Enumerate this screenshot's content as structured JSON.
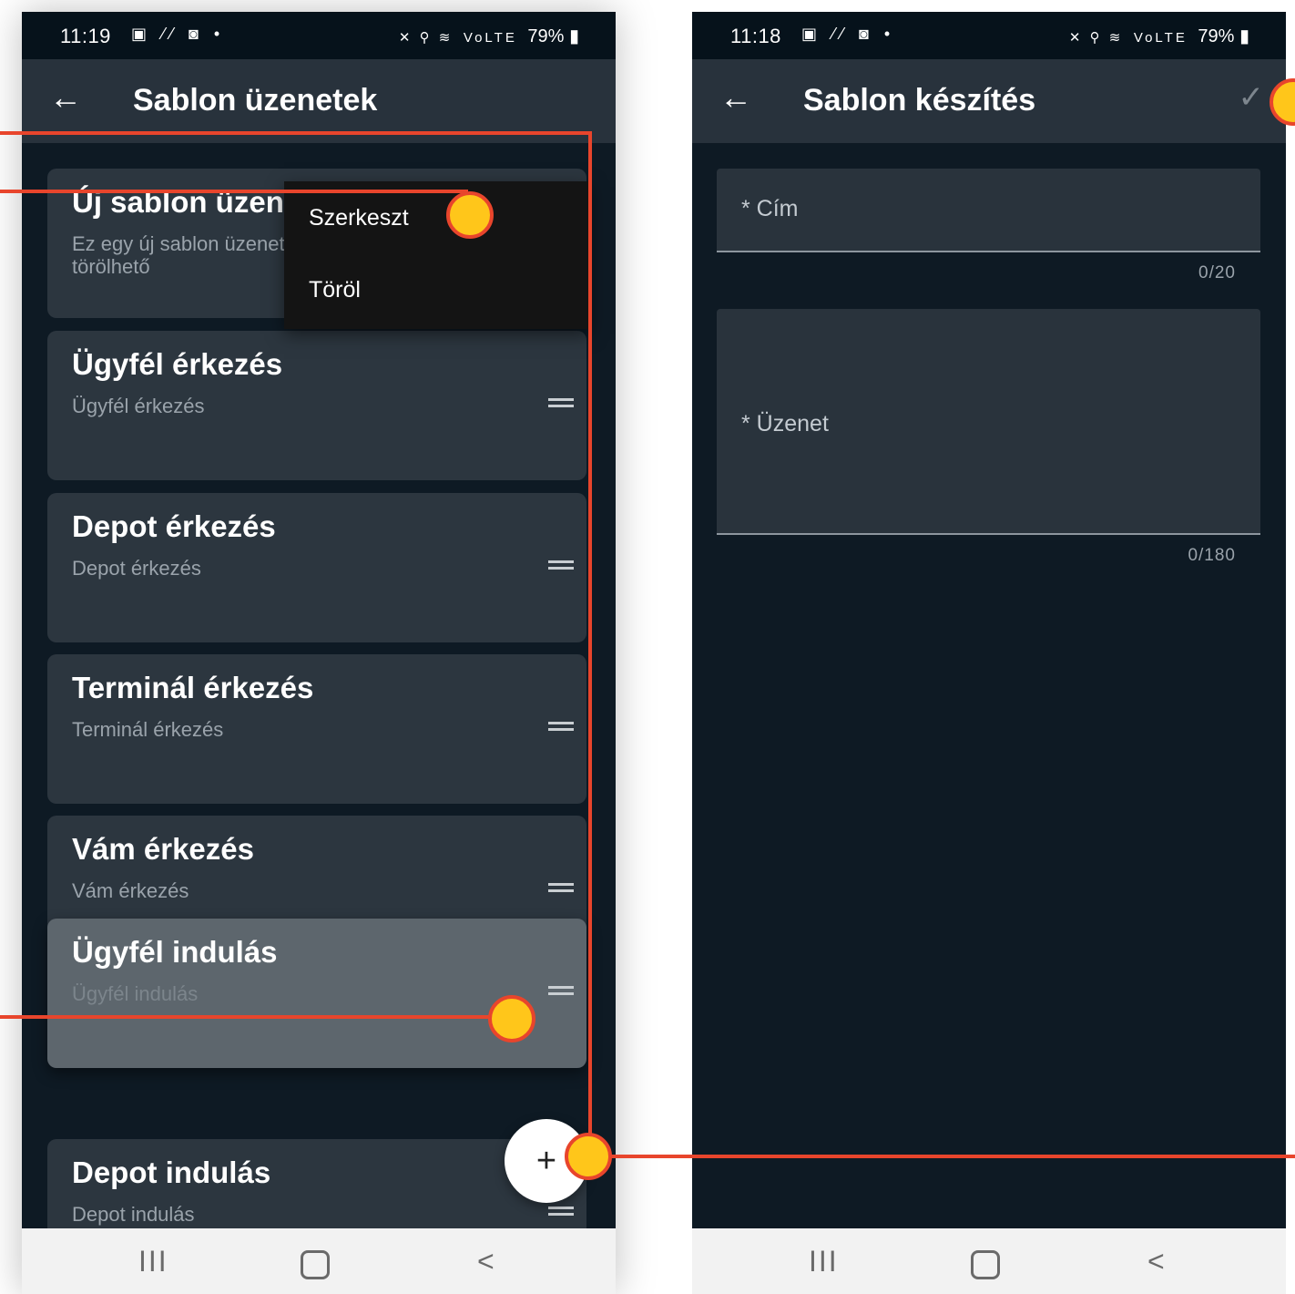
{
  "left_screen": {
    "status": {
      "time": "11:19",
      "icons": "▣ ⁄⁄ ◙ •",
      "right_icons": "✕ ⚲ ≋",
      "network": "VoLTE",
      "battery": "79%"
    },
    "appbar": {
      "back_icon": "←",
      "title": "Sablon üzenetek"
    },
    "cards": [
      {
        "title": "Új sablon üzenet",
        "subtitle": "Ez egy új sablon üzenet törölhető"
      },
      {
        "title": "Ügyfél érkezés",
        "subtitle": "Ügyfél érkezés"
      },
      {
        "title": "Depot érkezés",
        "subtitle": "Depot érkezés"
      },
      {
        "title": "Terminál érkezés",
        "subtitle": "Terminál érkezés"
      },
      {
        "title": "Vám érkezés",
        "subtitle": "Vám érkezés"
      },
      {
        "title": "Ügyfél indulás",
        "subtitle": "Ügyfél indulás"
      },
      {
        "title": "Depot indulás",
        "subtitle": "Depot indulás"
      }
    ],
    "menu": {
      "edit": "Szerkeszt",
      "delete": "Töröl"
    },
    "fab_label": "+",
    "navbar": {
      "recents": "III",
      "back": "<"
    }
  },
  "right_screen": {
    "status": {
      "time": "11:18",
      "icons": "▣ ⁄⁄ ◙ •",
      "right_icons": "✕ ⚲ ≋",
      "network": "VoLTE",
      "battery": "79%"
    },
    "appbar": {
      "back_icon": "←",
      "title": "Sablon készítés",
      "confirm_icon": "✓"
    },
    "fields": {
      "title_label": "* Cím",
      "title_counter": "0/20",
      "message_label": "* Üzenet",
      "message_counter": "0/180"
    },
    "navbar": {
      "recents": "III",
      "back": "<"
    }
  },
  "colors": {
    "annotation_line": "#e8452c",
    "annotation_dot": "#ffc61a",
    "screen_bg": "#0e1a24",
    "card_bg": "#2c363f"
  }
}
